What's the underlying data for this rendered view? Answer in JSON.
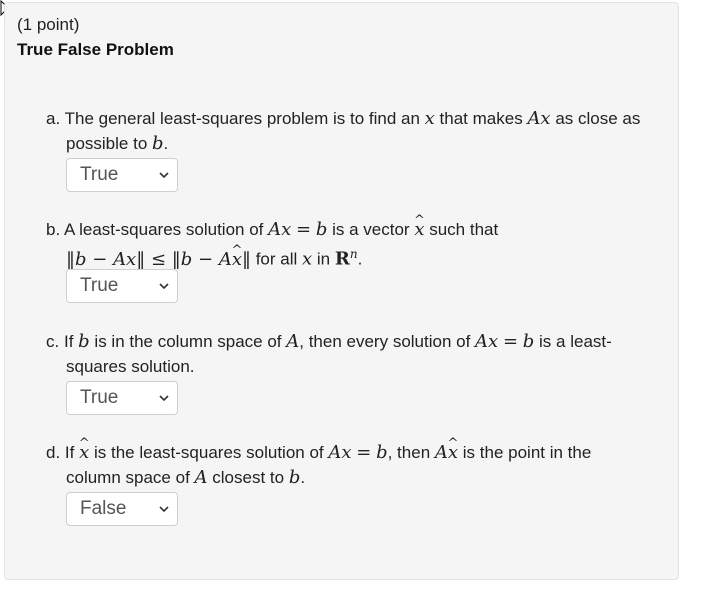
{
  "problem": {
    "points": "(1 point)",
    "title": "True False Problem"
  },
  "items": [
    {
      "letter": "a.",
      "selected": "True",
      "text": {
        "p1": "The general least-squares problem is to find an",
        "p2": "that makes",
        "p3": "as close as",
        "p4": "possible to",
        "p5": "."
      }
    },
    {
      "letter": "b.",
      "selected": "True",
      "text": {
        "p1": "A least-squares solution of",
        "p2": "is a vector",
        "p3": "such that",
        "p4": "for all",
        "p5": "in",
        "p6": "."
      }
    },
    {
      "letter": "c.",
      "selected": "True",
      "text": {
        "p1": "If",
        "p2": "is in the column space of",
        "p3": ", then every solution of",
        "p4": "is a least-",
        "p5": "squares solution."
      }
    },
    {
      "letter": "d.",
      "selected": "False",
      "text": {
        "p1": "If",
        "p2": "is the least-squares solution of",
        "p3": ", then",
        "p4": "is the point in the",
        "p5": "column space of",
        "p6": "closest to",
        "p7": "."
      }
    }
  ],
  "options": [
    "True",
    "False"
  ],
  "icons": {
    "cursor": "mouse-pointer-icon",
    "dropdown": "chevron-down-icon"
  }
}
